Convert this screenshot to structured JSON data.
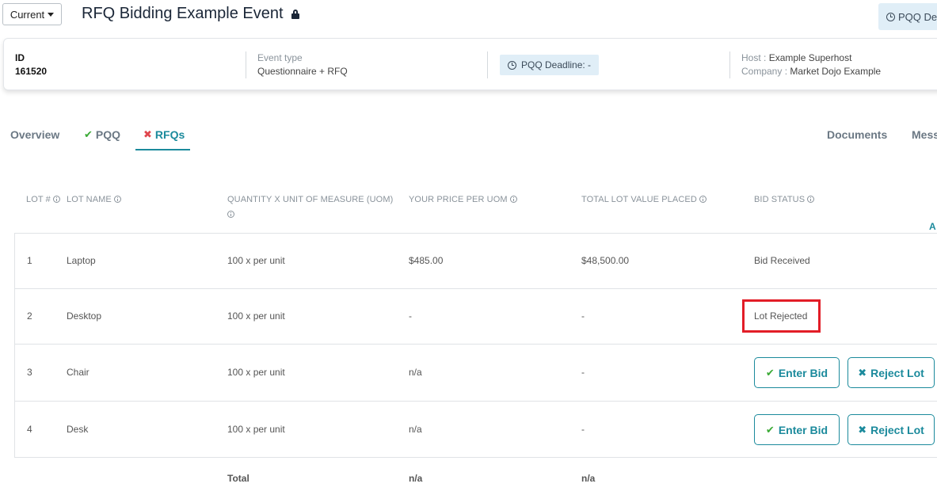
{
  "header": {
    "version_select": "Current",
    "title": "RFQ Bidding Example Event",
    "pqq_badge": "PQQ De"
  },
  "info": {
    "id_label": "ID",
    "id_value": "161520",
    "event_type_label": "Event type",
    "event_type_value": "Questionnaire + RFQ",
    "pqq_deadline": "PQQ Deadline: -",
    "host_label": "Host :",
    "host_value": "Example Superhost",
    "company_label": "Company :",
    "company_value": "Market Dojo Example"
  },
  "tabs": {
    "overview": "Overview",
    "pqq": "PQQ",
    "rfqs": "RFQs",
    "documents": "Documents",
    "messages": "Mess"
  },
  "table": {
    "headers": {
      "lot_num": "LOT #",
      "lot_name": "LOT NAME",
      "qty_uom": "QUANTITY X UNIT OF MEASURE (UOM)",
      "price": "YOUR PRICE PER UOM",
      "total_value": "TOTAL LOT VALUE PLACED",
      "status": "BID STATUS"
    },
    "side_link": "A",
    "rows": [
      {
        "num": "1",
        "name": "Laptop",
        "qty": "100 x per unit",
        "price": "$485.00",
        "total": "$48,500.00",
        "status": "Bid Received"
      },
      {
        "num": "2",
        "name": "Desktop",
        "qty": "100 x per unit",
        "price": "-",
        "total": "-",
        "status": "Lot Rejected"
      },
      {
        "num": "3",
        "name": "Chair",
        "qty": "100 x per unit",
        "price": "n/a",
        "total": "-",
        "enter_bid": "Enter Bid",
        "reject_lot": "Reject Lot"
      },
      {
        "num": "4",
        "name": "Desk",
        "qty": "100 x per unit",
        "price": "n/a",
        "total": "-",
        "enter_bid": "Enter Bid",
        "reject_lot": "Reject Lot"
      }
    ],
    "footer": {
      "label": "Total",
      "price": "n/a",
      "total": "n/a"
    }
  },
  "colors": {
    "accent": "#1b8a9c",
    "success": "#3aaa35",
    "danger": "#e0464d",
    "highlight": "#e21d27"
  }
}
